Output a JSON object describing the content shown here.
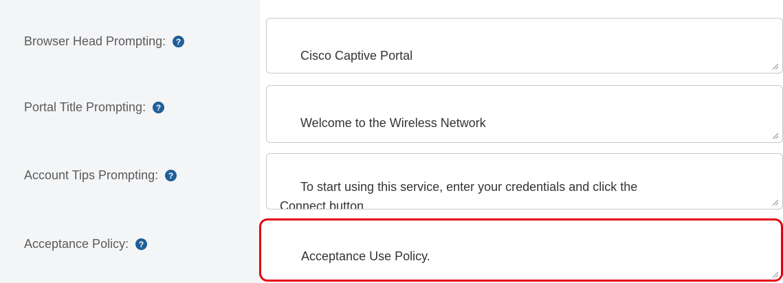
{
  "form": {
    "rows": [
      {
        "label": "Browser Head Prompting:",
        "value": "Cisco Captive Portal"
      },
      {
        "label": "Portal Title Prompting:",
        "value": "Welcome to the Wireless Network"
      },
      {
        "label": "Account Tips Prompting:",
        "value": "To start using this service, enter your credentials and click the\nConnect button."
      },
      {
        "label": "Acceptance Policy:",
        "value": "Acceptance Use Policy."
      }
    ],
    "help_glyph": "?"
  },
  "icons": {
    "help": "help-circle-icon",
    "resize": "resize-grip-icon"
  },
  "colors": {
    "label_panel_bg": "#f4f5f7",
    "help_icon": "#1f5f99",
    "highlight": "#e3000f",
    "field_border": "#c8c8c8"
  }
}
